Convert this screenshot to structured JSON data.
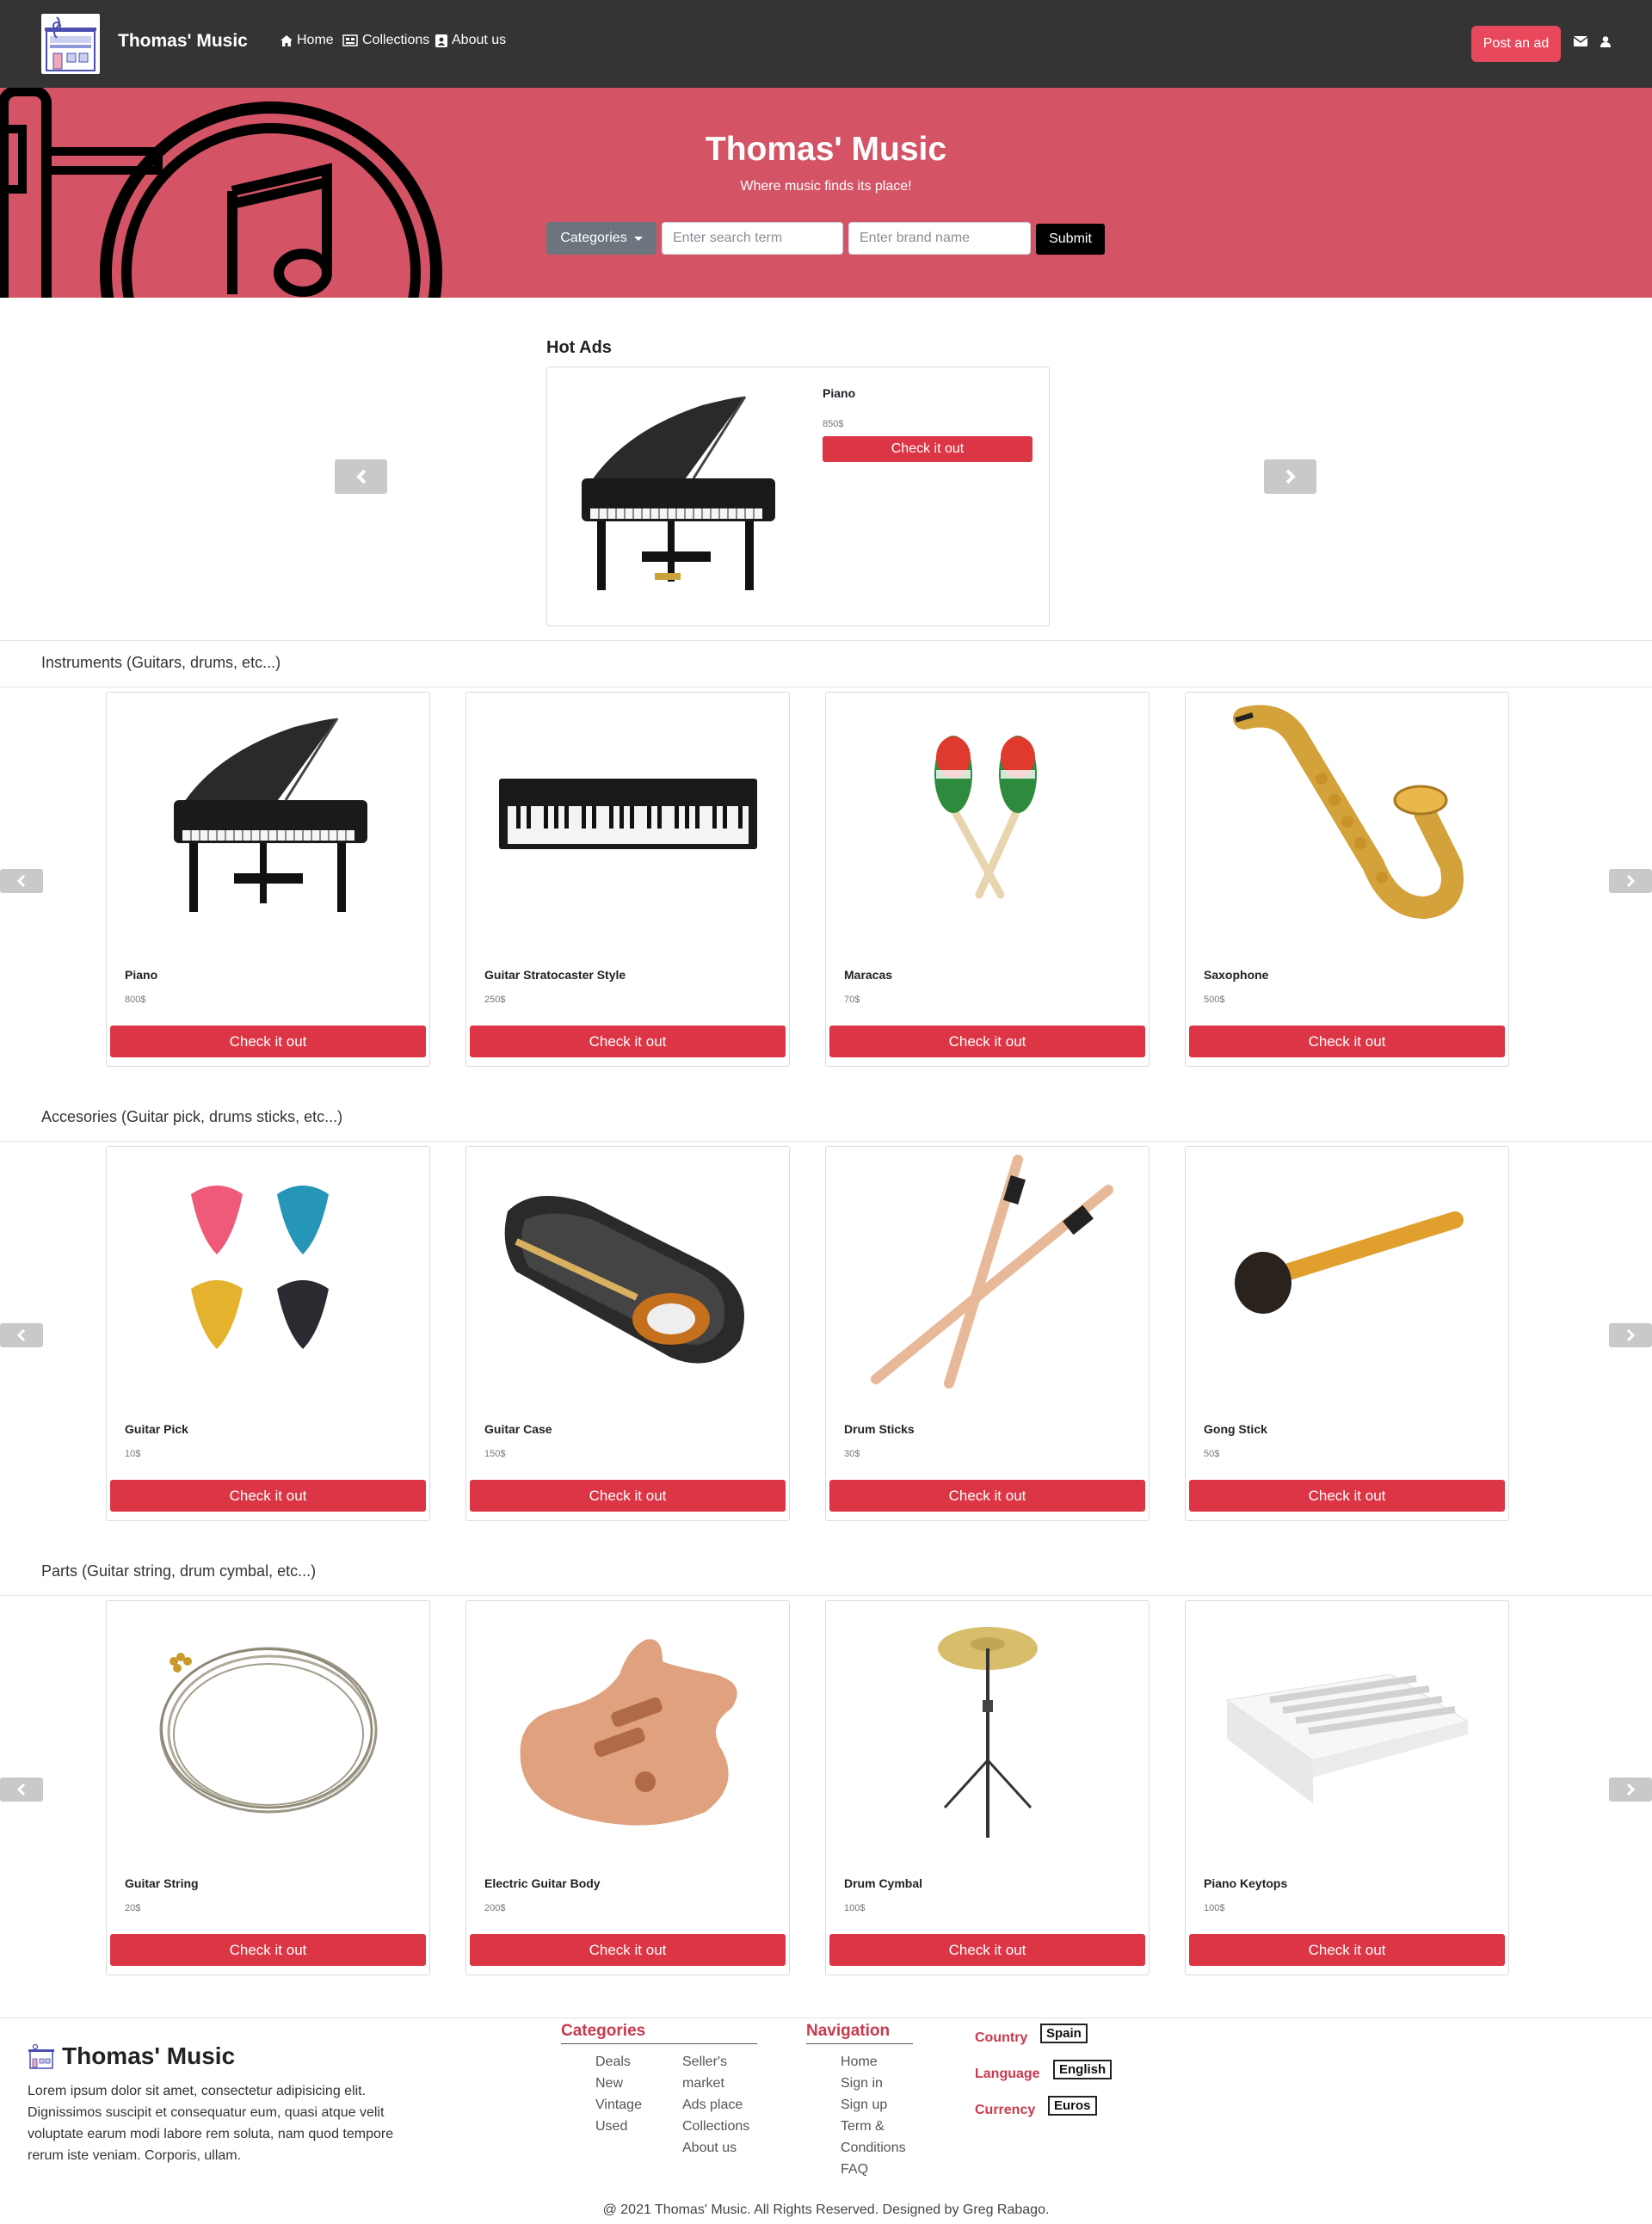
{
  "nav": {
    "brand": "Thomas' Music",
    "links": [
      "Home",
      "Collections",
      "About us"
    ],
    "post_ad": "Post an ad"
  },
  "hero": {
    "title": "Thomas' Music",
    "subtitle": "Where music finds its place!",
    "categories_label": "Categories",
    "search_placeholder": "Enter search term",
    "brand_placeholder": "Enter brand name",
    "submit": "Submit"
  },
  "hot_ads": {
    "title": "Hot Ads",
    "item": {
      "name": "Piano",
      "price": "850$",
      "button": "Check it out"
    }
  },
  "sections": [
    {
      "title": "Instruments (Guitars, drums, etc...)",
      "items": [
        {
          "name": "Piano",
          "price": "800$",
          "button": "Check it out"
        },
        {
          "name": "Guitar Stratocaster Style",
          "price": "250$",
          "button": "Check it out"
        },
        {
          "name": "Maracas",
          "price": "70$",
          "button": "Check it out"
        },
        {
          "name": "Saxophone",
          "price": "500$",
          "button": "Check it out"
        }
      ]
    },
    {
      "title": "Accesories (Guitar pick, drums sticks, etc...)",
      "items": [
        {
          "name": "Guitar Pick",
          "price": "10$",
          "button": "Check it out"
        },
        {
          "name": "Guitar Case",
          "price": "150$",
          "button": "Check it out"
        },
        {
          "name": "Drum Sticks",
          "price": "30$",
          "button": "Check it out"
        },
        {
          "name": "Gong Stick",
          "price": "50$",
          "button": "Check it out"
        }
      ]
    },
    {
      "title": "Parts (Guitar string, drum cymbal, etc...)",
      "items": [
        {
          "name": "Guitar String",
          "price": "20$",
          "button": "Check it out"
        },
        {
          "name": "Electric Guitar Body",
          "price": "200$",
          "button": "Check it out"
        },
        {
          "name": "Drum Cymbal",
          "price": "100$",
          "button": "Check it out"
        },
        {
          "name": "Piano Keytops",
          "price": "100$",
          "button": "Check it out"
        }
      ]
    }
  ],
  "footer": {
    "brand": "Thomas' Music",
    "text": "Lorem ipsum dolor sit amet, consectetur adipisicing elit. Dignissimos suscipit et consequatur eum, quasi atque velit voluptate earum modi labore rem soluta, nam quod tempore rerum iste veniam. Corporis, ullam.",
    "categories_title": "Categories",
    "categories_col1": [
      "Deals",
      "New",
      "Vintage",
      "Used"
    ],
    "categories_col2": [
      "Seller's",
      "market",
      "Ads place",
      "Collections",
      "About us"
    ],
    "navigation_title": "Navigation",
    "navigation": [
      "Home",
      "Sign in",
      "Sign up",
      "Term &",
      "Conditions",
      "FAQ"
    ],
    "country_label": "Country",
    "country_value": "Spain",
    "language_label": "Language",
    "language_value": "English",
    "currency_label": "Currency",
    "currency_value": "Euros",
    "copyright": "@ 2021 Thomas' Music. All Rights Reserved. Designed by Greg Rabago."
  },
  "colors": {
    "navbar": "#343434",
    "hero": "#d45466",
    "accent_red": "#dc3545",
    "post_ad": "#e8485c",
    "footer_heading": "#c9394d"
  },
  "icons": [
    "home-icon",
    "collections-icon",
    "about-icon",
    "envelope-icon",
    "user-icon",
    "chevron-left-icon",
    "chevron-right-icon"
  ]
}
